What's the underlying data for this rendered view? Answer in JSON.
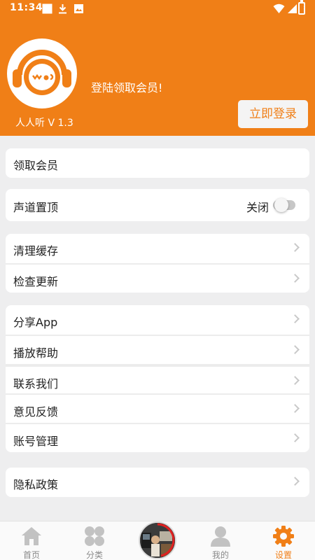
{
  "status_bar": {
    "time": "11:34"
  },
  "header": {
    "app_version": "人人听 V 1.3",
    "message": "登陆领取会员!",
    "login_button": "立即登录"
  },
  "colors": {
    "accent": "#f07f17",
    "background": "#eeeeef"
  },
  "sections": {
    "membership": {
      "label": "领取会员"
    },
    "channel_top": {
      "label": "声道置顶",
      "toggle_label": "关闭",
      "toggle_on": false
    },
    "clear_cache": {
      "label": "清理缓存"
    },
    "check_update": {
      "label": "检查更新"
    },
    "share_app": {
      "label": "分享App"
    },
    "play_help": {
      "label": "播放帮助"
    },
    "contact_us": {
      "label": "联系我们"
    },
    "feedback": {
      "label": "意见反馈"
    },
    "account_mgmt": {
      "label": "账号管理"
    },
    "privacy_policy": {
      "label": "隐私政策"
    }
  },
  "tabbar": {
    "home": {
      "label": "首页",
      "icon": "home-icon"
    },
    "category": {
      "label": "分类",
      "icon": "grid-icon"
    },
    "mine": {
      "label": "我的",
      "icon": "user-icon"
    },
    "settings": {
      "label": "设置",
      "icon": "gear-icon",
      "active": true
    }
  }
}
